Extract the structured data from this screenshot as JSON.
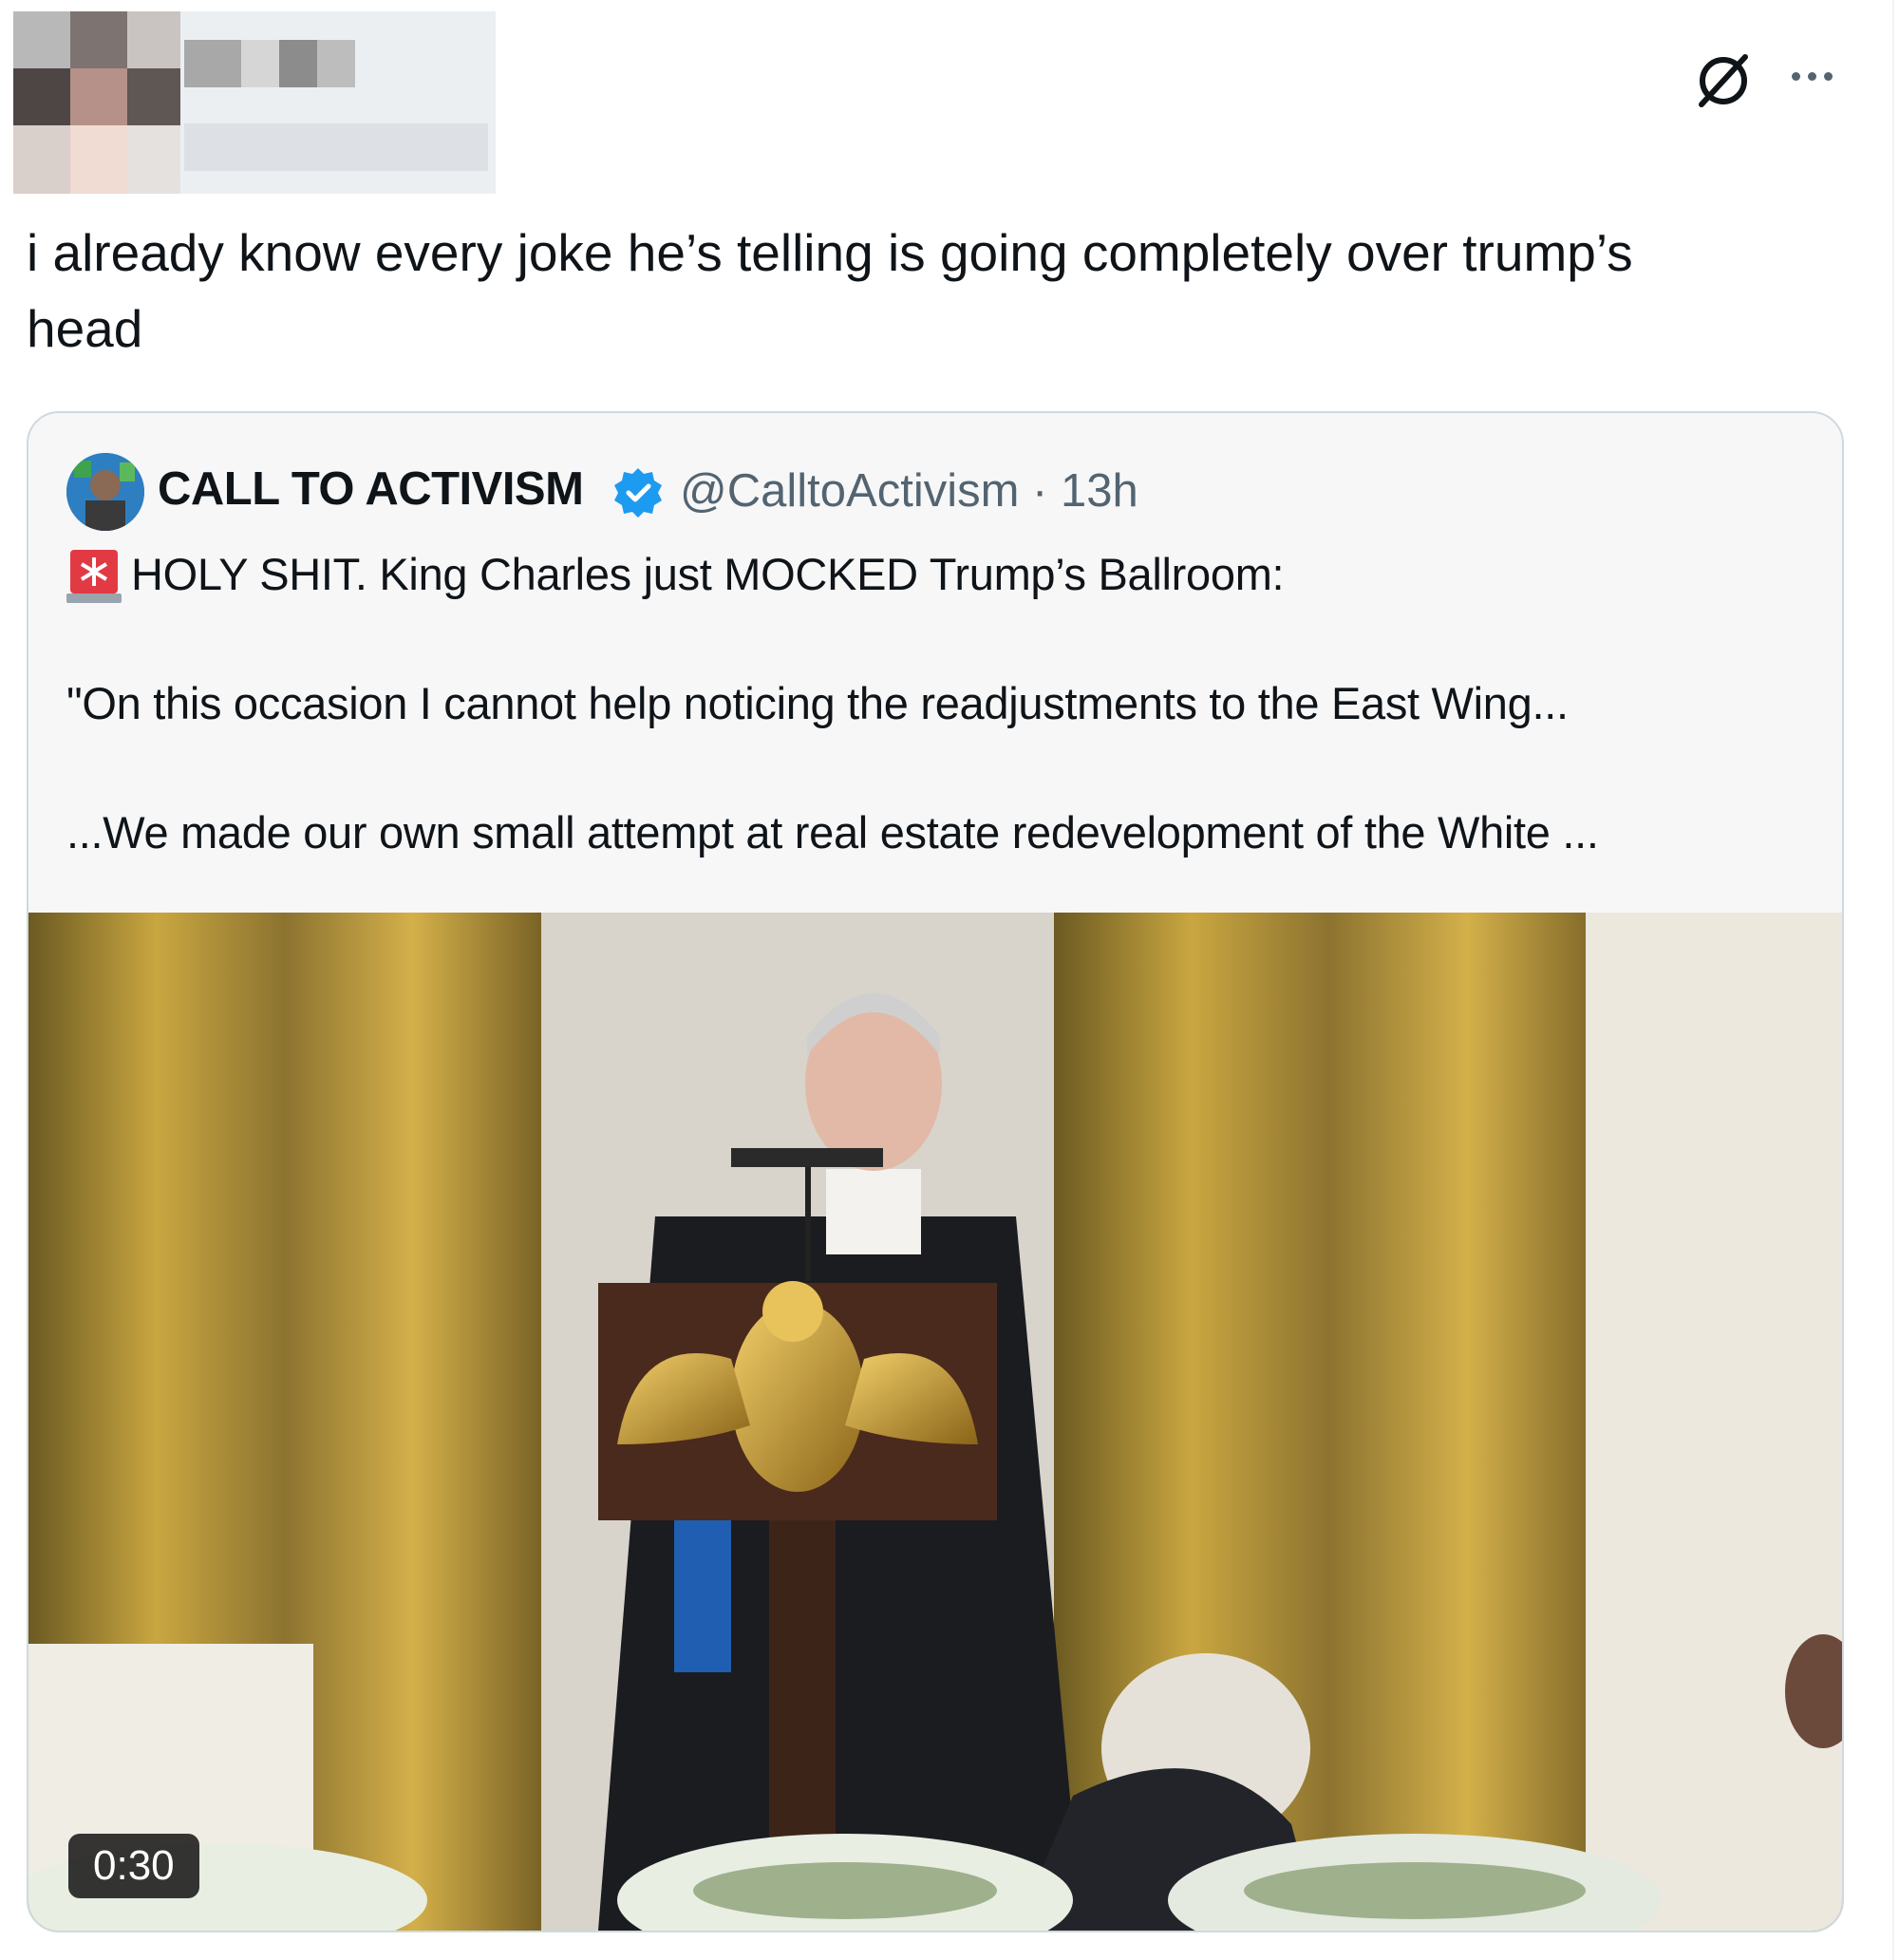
{
  "tweet": {
    "text": "i already know every joke he’s telling is going completely over trump’s\nhead"
  },
  "header": {
    "grok_icon": "grok-icon",
    "more_icon": "more-icon"
  },
  "quote": {
    "name": "CALL TO ACTIVISM",
    "verified_icon": "verified-badge-icon",
    "handle_time": "@CalltoActivism · 13h",
    "line1": "HOLY SHIT. King Charles just MOCKED Trump’s Ballroom:",
    "line2": "\"On this occasion I cannot help noticing the readjustments to the East Wing...",
    "line3": "...We made our own small attempt at real estate redevelopment of the White ...",
    "siren_icon": "siren-icon"
  },
  "video": {
    "duration": "0:30"
  },
  "colors": {
    "text": "#0f1419",
    "secondary": "#536471",
    "verified": "#1d9bf0",
    "card_bg": "#f7f7f8",
    "border": "#cfd9de"
  }
}
